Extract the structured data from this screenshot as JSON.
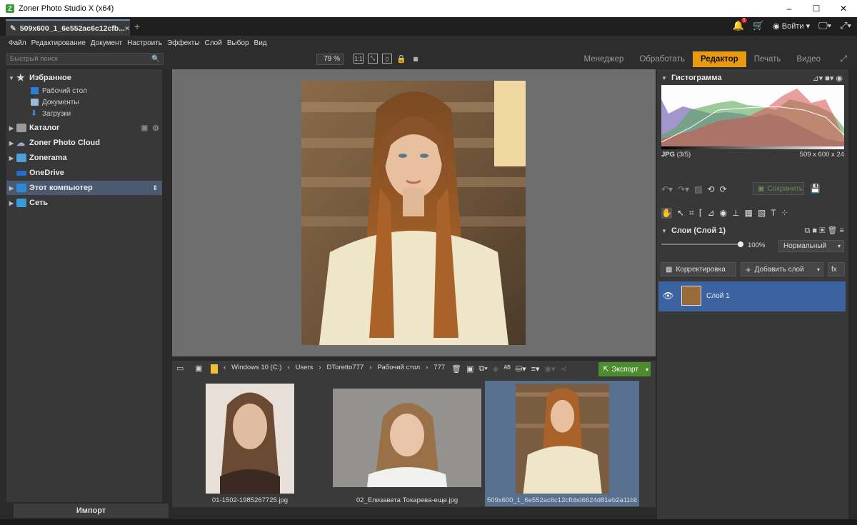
{
  "window": {
    "title": "Zoner Photo Studio X (x64)",
    "app_icon": "Z",
    "controls": [
      "–",
      "☐",
      "✕"
    ]
  },
  "tab": {
    "label": "509x600_1_6e552ac6c12cfb...",
    "close": "×",
    "new": "+"
  },
  "topright": {
    "notifications_count": "1",
    "login_label": "Войти",
    "login_arrow": "▾"
  },
  "menu": [
    "Файл",
    "Редактирование",
    "Документ",
    "Настроить",
    "Эффекты",
    "Слой",
    "Выбор",
    "Вид"
  ],
  "search": {
    "placeholder": "Быстрый поиск"
  },
  "zoom": {
    "value": "79 %"
  },
  "modules": {
    "manager": "Менеджер",
    "develop": "Обработать",
    "editor": "Редактор",
    "print": "Печать",
    "video": "Видео",
    "active": "Редактор"
  },
  "navigator": {
    "favorites": "Избранное",
    "desktop": "Рабочий стол",
    "documents": "Документы",
    "downloads": "Загрузки",
    "catalog": "Каталог",
    "cloud": "Zoner Photo Cloud",
    "zonerama": "Zonerama",
    "onedrive": "OneDrive",
    "this_pc": "Этот компьютер",
    "network": "Сеть"
  },
  "import_button": "Импорт",
  "breadcrumb": {
    "drive": "Windows 10 (C:)",
    "users": "Users",
    "user": "DToretto777",
    "desktop": "Рабочий стол",
    "folder": "777"
  },
  "export_button": "Экспорт",
  "thumbnails": [
    {
      "caption": "01-1502-1985267725.jpg",
      "selected": false
    },
    {
      "caption": "02_Елизавета Токарева-еще.jpg",
      "selected": false
    },
    {
      "caption": "509x600_1_6e552ac6c12cfbbd6624d81eb2a11bb2...",
      "selected": true
    }
  ],
  "histogram": {
    "title": "Гистограмма",
    "format": "JPG",
    "index": "(3/5)",
    "dimensions": "509 x 600 x 24"
  },
  "save_button": "Сохранить",
  "layers": {
    "title": "Слои (Слой 1)",
    "opacity": "100%",
    "opacity_fraction": 1.0,
    "blend_mode": "Нормальный",
    "correction_button": "Корректировка",
    "add_layer_button": "Добавить слой",
    "fx": "fx",
    "items": [
      {
        "name": "Слой 1",
        "visible": true,
        "selected": true
      }
    ]
  },
  "colors": {
    "accent": "#e89a12",
    "selected": "#58708f",
    "export": "#4c8b2e",
    "layer_selected": "#3d62a0"
  }
}
